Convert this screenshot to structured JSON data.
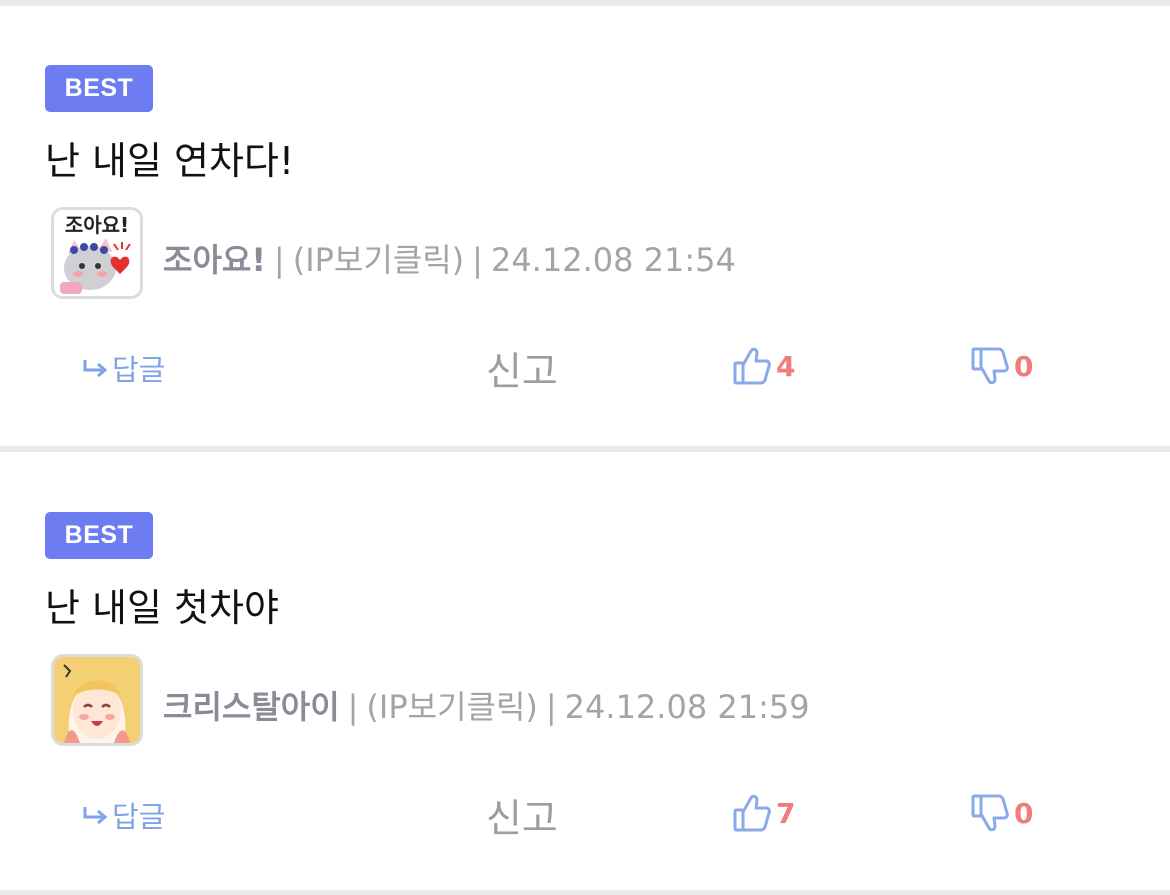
{
  "colors": {
    "badge": "#6d7cf0",
    "reply": "#7fa3e6",
    "vote_icon": "#8aa9ea",
    "vote_count": "#f07c7c",
    "meta": "#a3a3a9",
    "divider": "#e9e9ea"
  },
  "comments": [
    {
      "badge": "BEST",
      "text": "난 내일 연차다!",
      "avatar": {
        "icon": "cat-sticker-avatar",
        "caption": "조아요!"
      },
      "author": "조아요!",
      "ip": "(IP보기클릭)",
      "datetime": "24.12.08 21:54",
      "reply_label": "답글",
      "report_label": "신고",
      "likes": "4",
      "dislikes": "0"
    },
    {
      "badge": "BEST",
      "text": "난 내일 첫차야",
      "avatar": {
        "icon": "anime-girl-avatar"
      },
      "author": "크리스탈아이",
      "ip": "(IP보기클릭)",
      "datetime": "24.12.08 21:59",
      "reply_label": "답글",
      "report_label": "신고",
      "likes": "7",
      "dislikes": "0"
    }
  ]
}
